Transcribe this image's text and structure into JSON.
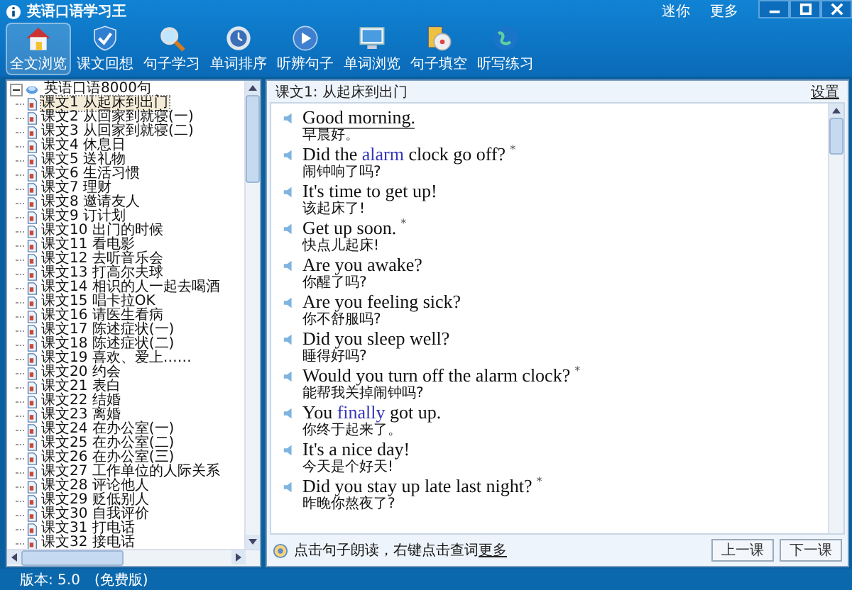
{
  "window": {
    "title": "英语口语学习王",
    "links": [
      "迷你",
      "更多"
    ]
  },
  "toolbar": [
    {
      "label": "全文浏览",
      "selected": true
    },
    {
      "label": "课文回想",
      "selected": false
    },
    {
      "label": "句子学习",
      "selected": false
    },
    {
      "label": "单词排序",
      "selected": false
    },
    {
      "label": "听辨句子",
      "selected": false
    },
    {
      "label": "单词浏览",
      "selected": false
    },
    {
      "label": "句子填空",
      "selected": false
    },
    {
      "label": "听写练习",
      "selected": false
    }
  ],
  "tree": {
    "label": "英语口语8000句",
    "expanded": true,
    "children": [
      {
        "label": "课文1 从起床到出门",
        "selected": true
      },
      {
        "label": "课文2 从回家到就寝(一)",
        "selected": false
      },
      {
        "label": "课文3 从回家到就寝(二)",
        "selected": false
      },
      {
        "label": "课文4 休息日",
        "selected": false
      },
      {
        "label": "课文5 送礼物",
        "selected": false
      },
      {
        "label": "课文6 生活习惯",
        "selected": false
      },
      {
        "label": "课文7 理财",
        "selected": false
      },
      {
        "label": "课文8 邀请友人",
        "selected": false
      },
      {
        "label": "课文9 订计划",
        "selected": false
      },
      {
        "label": "课文10 出门的时候",
        "selected": false
      },
      {
        "label": "课文11 看电影",
        "selected": false
      },
      {
        "label": "课文12 去听音乐会",
        "selected": false
      },
      {
        "label": "课文13 打高尔夫球",
        "selected": false
      },
      {
        "label": "课文14 相识的人一起去喝酒",
        "selected": false
      },
      {
        "label": "课文15 唱卡拉OK",
        "selected": false
      },
      {
        "label": "课文16 请医生看病",
        "selected": false
      },
      {
        "label": "课文17 陈述症状(一)",
        "selected": false
      },
      {
        "label": "课文18 陈述症状(二)",
        "selected": false
      },
      {
        "label": "课文19 喜欢、爱上……",
        "selected": false
      },
      {
        "label": "课文20 约会",
        "selected": false
      },
      {
        "label": "课文21 表白",
        "selected": false
      },
      {
        "label": "课文22 结婚",
        "selected": false
      },
      {
        "label": "课文23 离婚",
        "selected": false
      },
      {
        "label": "课文24 在办公室(一)",
        "selected": false
      },
      {
        "label": "课文25 在办公室(二)",
        "selected": false
      },
      {
        "label": "课文26 在办公室(三)",
        "selected": false
      },
      {
        "label": "课文27 工作单位的人际关系",
        "selected": false
      },
      {
        "label": "课文28 评论他人",
        "selected": false
      },
      {
        "label": "课文29 贬低别人",
        "selected": false
      },
      {
        "label": "课文30 自我评价",
        "selected": false
      },
      {
        "label": "课文31 打电话",
        "selected": false
      },
      {
        "label": "课文32 接电话",
        "selected": false
      }
    ]
  },
  "lesson": {
    "title": "课文1: 从起床到出门",
    "settings_link": "设置",
    "sentences": [
      {
        "parts": [
          {
            "text": "Good morning.",
            "linked": false
          }
        ],
        "zh": "早晨好。",
        "selected": true
      },
      {
        "parts": [
          {
            "text": "Did the ",
            "linked": false
          },
          {
            "text": "alarm",
            "linked": true
          },
          {
            "text": " clock go off?",
            "linked": false
          }
        ],
        "mark": "*",
        "zh": "闹钟响了吗?",
        "selected": false
      },
      {
        "parts": [
          {
            "text": "It's time to get up!",
            "linked": false
          }
        ],
        "zh": "该起床了!",
        "selected": false
      },
      {
        "parts": [
          {
            "text": "Get up soon.",
            "linked": false
          }
        ],
        "mark": "*",
        "zh": "快点儿起床!",
        "selected": false
      },
      {
        "parts": [
          {
            "text": "Are you awake?",
            "linked": false
          }
        ],
        "zh": "你醒了吗?",
        "selected": false
      },
      {
        "parts": [
          {
            "text": "Are you feeling sick?",
            "linked": false
          }
        ],
        "zh": "你不舒服吗?",
        "selected": false
      },
      {
        "parts": [
          {
            "text": "Did you sleep well?",
            "linked": false
          }
        ],
        "zh": "睡得好吗?",
        "selected": false
      },
      {
        "parts": [
          {
            "text": "Would you turn off the alarm clock?",
            "linked": false
          }
        ],
        "mark": "*",
        "zh": "能帮我关掉闹钟吗?",
        "selected": false
      },
      {
        "parts": [
          {
            "text": "You ",
            "linked": false
          },
          {
            "text": "finally",
            "linked": true
          },
          {
            "text": " got up.",
            "linked": false
          }
        ],
        "zh": "你终于起来了。",
        "selected": false
      },
      {
        "parts": [
          {
            "text": "It's a nice day!",
            "linked": false
          }
        ],
        "zh": "今天是个好天!",
        "selected": false
      },
      {
        "parts": [
          {
            "text": "Did you stay up late last night?",
            "linked": false
          }
        ],
        "mark": "*",
        "zh": "昨晚你熬夜了?",
        "selected": false
      }
    ],
    "hint": "点击句子朗读，右键点击查词",
    "hint_link": "更多",
    "buttons": [
      "上一课",
      "下一课"
    ]
  },
  "status_bar": {
    "version": "版本: 5.0",
    "edition": "(免费版)"
  }
}
